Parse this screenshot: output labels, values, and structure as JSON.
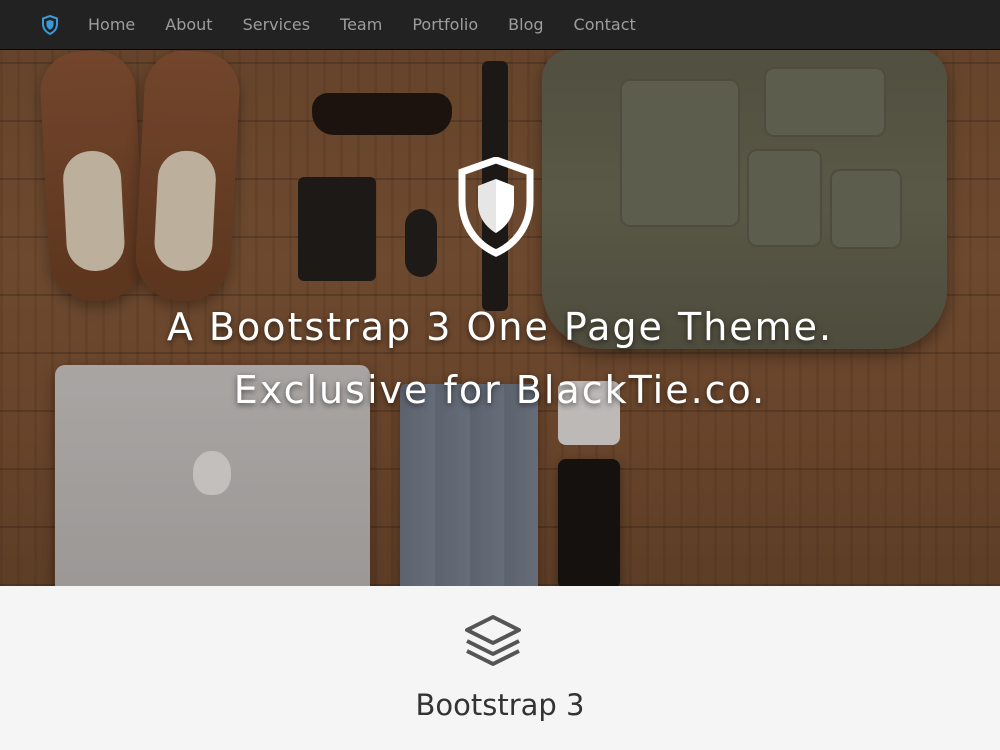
{
  "navbar": {
    "brand_icon": "shield-icon",
    "links": [
      "Home",
      "About",
      "Services",
      "Team",
      "Portfolio",
      "Blog",
      "Contact"
    ]
  },
  "hero": {
    "logo_icon": "shield-icon",
    "title_line1": "A Bootstrap 3 One Page Theme.",
    "title_line2": "Exclusive for BlackTie.co."
  },
  "section": {
    "icon": "layers-icon",
    "title": "Bootstrap 3"
  },
  "colors": {
    "navbar_bg": "#222222",
    "nav_text": "#9d9d9d",
    "brand_accent": "#3a9ad9",
    "section_bg": "#f5f5f5",
    "section_title": "#333333"
  }
}
